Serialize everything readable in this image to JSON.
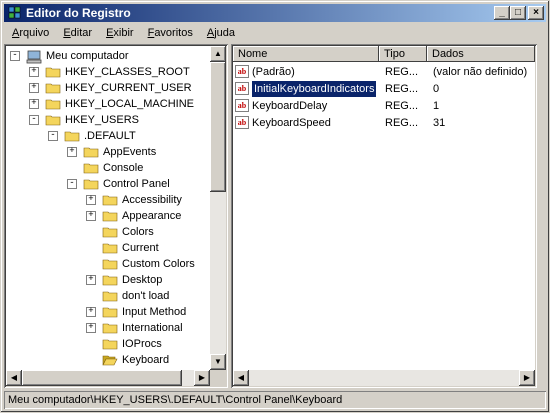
{
  "window": {
    "title": "Editor do Registro"
  },
  "menu": [
    "Arquivo",
    "Editar",
    "Exibir",
    "Favoritos",
    "Ajuda"
  ],
  "tree": [
    {
      "label": "Meu computador",
      "depth": 0,
      "exp": "-",
      "icon": "computer"
    },
    {
      "label": "HKEY_CLASSES_ROOT",
      "depth": 1,
      "exp": "+",
      "icon": "folder"
    },
    {
      "label": "HKEY_CURRENT_USER",
      "depth": 1,
      "exp": "+",
      "icon": "folder"
    },
    {
      "label": "HKEY_LOCAL_MACHINE",
      "depth": 1,
      "exp": "+",
      "icon": "folder"
    },
    {
      "label": "HKEY_USERS",
      "depth": 1,
      "exp": "-",
      "icon": "folder"
    },
    {
      "label": ".DEFAULT",
      "depth": 2,
      "exp": "-",
      "icon": "folder"
    },
    {
      "label": "AppEvents",
      "depth": 3,
      "exp": "+",
      "icon": "folder"
    },
    {
      "label": "Console",
      "depth": 3,
      "exp": "",
      "icon": "folder"
    },
    {
      "label": "Control Panel",
      "depth": 3,
      "exp": "-",
      "icon": "folder"
    },
    {
      "label": "Accessibility",
      "depth": 4,
      "exp": "+",
      "icon": "folder"
    },
    {
      "label": "Appearance",
      "depth": 4,
      "exp": "+",
      "icon": "folder"
    },
    {
      "label": "Colors",
      "depth": 4,
      "exp": "",
      "icon": "folder"
    },
    {
      "label": "Current",
      "depth": 4,
      "exp": "",
      "icon": "folder"
    },
    {
      "label": "Custom Colors",
      "depth": 4,
      "exp": "",
      "icon": "folder"
    },
    {
      "label": "Desktop",
      "depth": 4,
      "exp": "+",
      "icon": "folder"
    },
    {
      "label": "don't load",
      "depth": 4,
      "exp": "",
      "icon": "folder"
    },
    {
      "label": "Input Method",
      "depth": 4,
      "exp": "+",
      "icon": "folder"
    },
    {
      "label": "International",
      "depth": 4,
      "exp": "+",
      "icon": "folder"
    },
    {
      "label": "IOProcs",
      "depth": 4,
      "exp": "",
      "icon": "folder"
    },
    {
      "label": "Keyboard",
      "depth": 4,
      "exp": "",
      "icon": "folder-open"
    }
  ],
  "columns": [
    "Nome",
    "Tipo",
    "Dados"
  ],
  "values": [
    {
      "name": "(Padrão)",
      "type": "REG...",
      "data": "(valor não definido)",
      "selected": false
    },
    {
      "name": "InitialKeyboardIndicators",
      "type": "REG...",
      "data": "0",
      "selected": true
    },
    {
      "name": "KeyboardDelay",
      "type": "REG...",
      "data": "1",
      "selected": false
    },
    {
      "name": "KeyboardSpeed",
      "type": "REG...",
      "data": "31",
      "selected": false
    }
  ],
  "status": "Meu computador\\HKEY_USERS\\.DEFAULT\\Control Panel\\Keyboard",
  "colors": {
    "title_start": "#0a246a",
    "title_end": "#a6caf0",
    "folder": "#f4d55c",
    "chrome": "#d4d0c8"
  },
  "icons": {
    "app": "registry-editor-icon",
    "value": "string-value-icon",
    "minimize": "minimize-icon",
    "maximize": "maximize-icon",
    "close": "close-icon"
  }
}
